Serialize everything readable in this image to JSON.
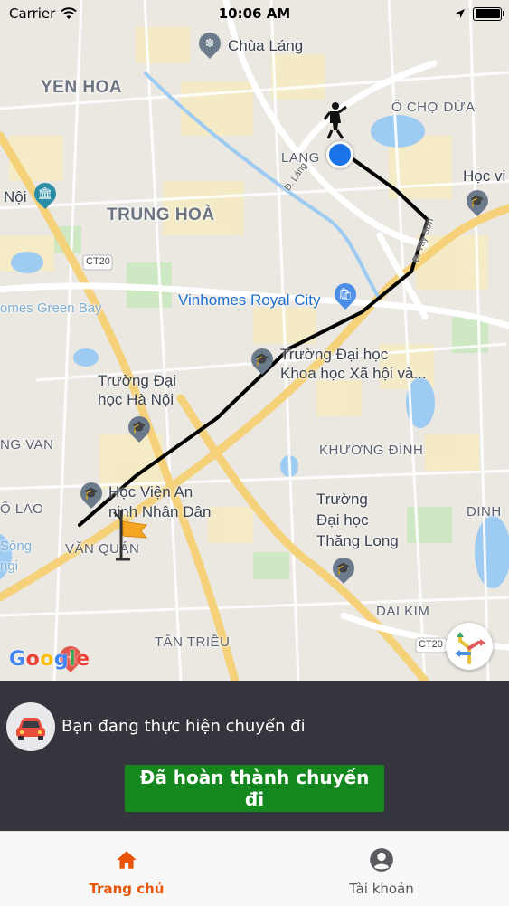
{
  "status_bar": {
    "carrier": "Carrier",
    "time": "10:06 AM",
    "battery_level": 1.0
  },
  "map": {
    "districts": {
      "yen_hoa": "YEN HOA",
      "o_cho_dua": "Ô CHỢ DỪA",
      "lang": "LANG",
      "trung_hoa": "TRUNG HOÀ",
      "khuong_dinh": "KHƯƠNG ĐÌNH",
      "dinh": "DINH",
      "dai_kim": "DAI KIM",
      "tan_trieu": "TÂN TRIỀU",
      "van_quan": "VĂN QUÁN",
      "ng_van": "NG VAN",
      "o_lao": "Ộ LAO"
    },
    "pois": {
      "chua_lang": "Chùa Láng",
      "hoc_vi": "Học vi",
      "noi": "Nội",
      "vinhomes": "Vinhomes Royal City",
      "green_bay": "omes Green Bay",
      "dh_khxh_1": "Trường Đại học",
      "dh_khxh_2": "Khoa học Xã hội và...",
      "dh_hanoi_1": "Trường Đại",
      "dh_hanoi_2": "học Hà Nội",
      "an_ninh_1": "Học Viện An",
      "an_ninh_2": "ninh Nhân Dân",
      "thang_long_1": "Trường",
      "thang_long_2": "Đại học",
      "thang_long_3": "Thăng Long",
      "song": "Sông",
      "ngi": "ngi"
    },
    "roads": {
      "ct20_top": "CT20",
      "ct20_bottom": "CT20",
      "tay_son": "Đ. Tây Sơn",
      "lang_road": "Đ. Láng"
    },
    "google_logo": "Google",
    "colors": {
      "route": "#000000",
      "user_location": "#1a73e8",
      "flag": "#f5a623"
    }
  },
  "trip_panel": {
    "status_text": "Bạn đang thực hiện chuyến đi",
    "complete_button": "Đã hoàn thành chuyến đi",
    "accent": "#14871f"
  },
  "tab_bar": {
    "home_label": "Trang chủ",
    "account_label": "Tài khoản",
    "active_color": "#e8550a",
    "inactive_color": "#555555"
  }
}
